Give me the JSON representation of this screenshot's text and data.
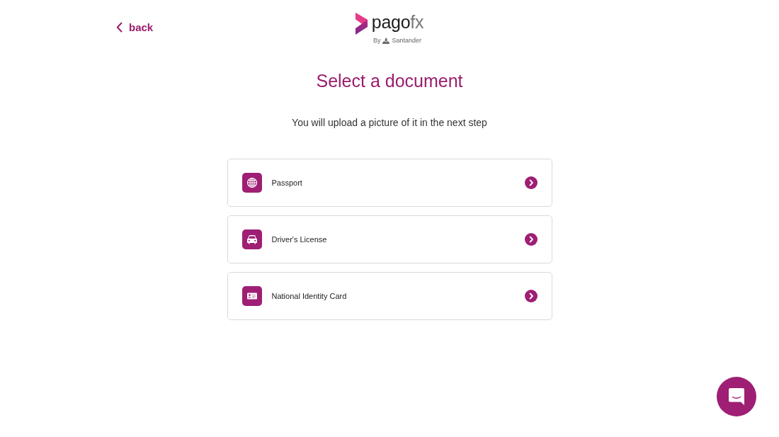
{
  "header": {
    "back": {
      "label": "back"
    },
    "logo": {
      "name": "pago",
      "suffix": "fx",
      "byline": "By",
      "brand": "Santander"
    }
  },
  "title": "Select a document",
  "subtitle": "You will upload a picture of it in the next step",
  "documents": [
    {
      "kind": "passport",
      "label": "Passport"
    },
    {
      "kind": "license",
      "label": "Driver's License"
    },
    {
      "kind": "id_card",
      "label": "National Identity Card"
    }
  ]
}
